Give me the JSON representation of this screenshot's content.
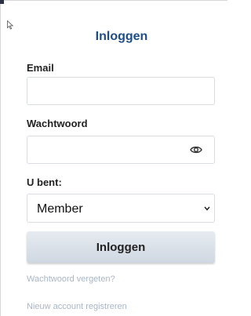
{
  "form": {
    "title": "Inloggen",
    "email": {
      "label": "Email",
      "value": "",
      "placeholder": ""
    },
    "password": {
      "label": "Wachtwoord",
      "value": "",
      "placeholder": "",
      "toggle_icon": "eye-icon"
    },
    "user_type": {
      "label": "U bent:",
      "selected": "Member",
      "icon": "chevron-down-icon"
    },
    "submit_label": "Inloggen",
    "links": {
      "forgot_password": "Wachtwoord vergeten?",
      "register": "Nieuw account registreren"
    }
  },
  "colors": {
    "title": "#1d4e89",
    "link": "#a9b7c7",
    "button_top": "#e7ebf1",
    "button_bottom": "#cfd8e2",
    "field_border": "#d9dde3"
  }
}
